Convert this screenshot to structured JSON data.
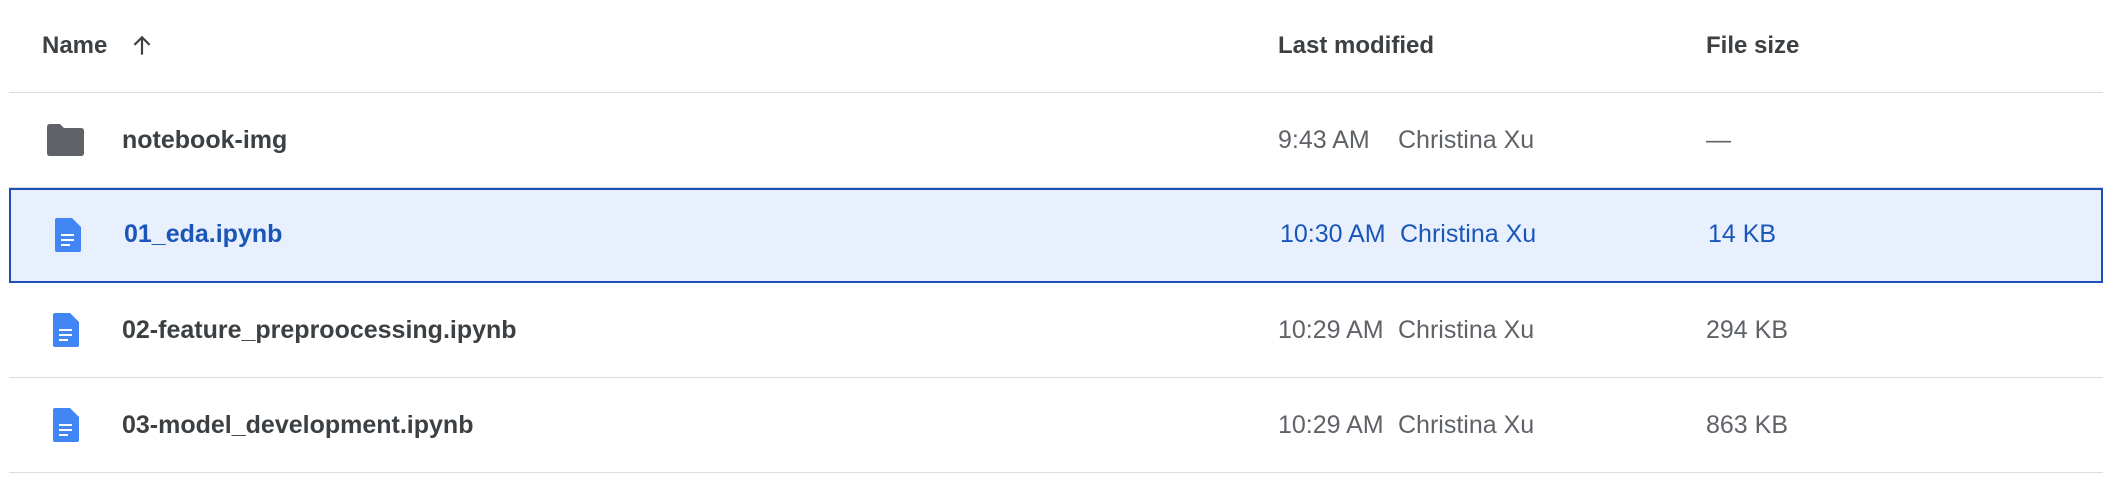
{
  "columns": {
    "name": "Name",
    "last_modified": "Last modified",
    "file_size": "File size",
    "sort_icon": "arrow-up-icon"
  },
  "rows": [
    {
      "icon": "folder-icon",
      "name": "notebook-img",
      "time": "9:43 AM",
      "owner": "Christina Xu",
      "size": "—",
      "selected": false
    },
    {
      "icon": "document-icon",
      "name": "01_eda.ipynb",
      "time": "10:30 AM",
      "owner": "Christina Xu",
      "size": "14 KB",
      "selected": true
    },
    {
      "icon": "document-icon",
      "name": "02-feature_preproocessing.ipynb",
      "time": "10:29 AM",
      "owner": "Christina Xu",
      "size": "294 KB",
      "selected": false
    },
    {
      "icon": "document-icon",
      "name": "03-model_development.ipynb",
      "time": "10:29 AM",
      "owner": "Christina Xu",
      "size": "863 KB",
      "selected": false
    }
  ],
  "colors": {
    "folder": "#5f6368",
    "document": "#4285f4",
    "selected_bg": "#e8f0fe",
    "selected_border": "#1f4fb8",
    "selected_text": "#1a56b8"
  }
}
